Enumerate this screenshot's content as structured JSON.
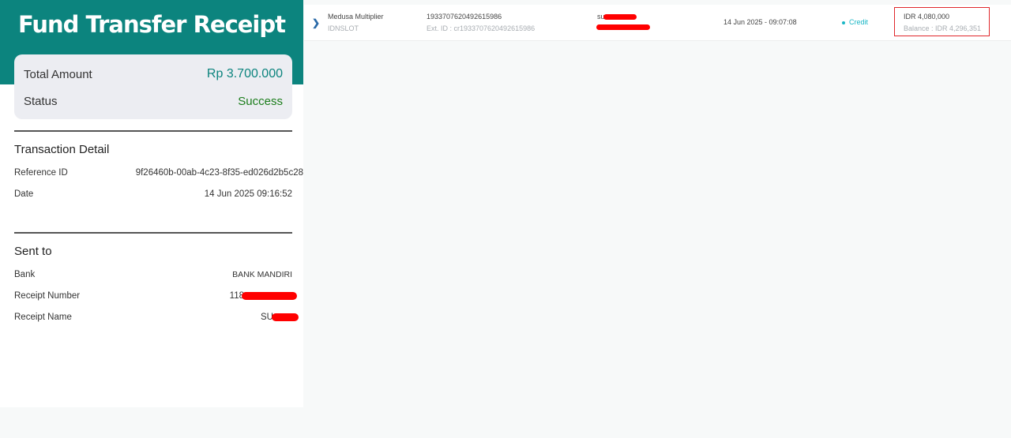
{
  "receipt": {
    "title": "Fund Transfer Receipt",
    "total_amount_label": "Total Amount",
    "total_amount_value": "Rp 3.700.000",
    "status_label": "Status",
    "status_value": "Success",
    "transaction_detail_heading": "Transaction Detail",
    "reference_id_label": "Reference ID",
    "reference_id_value": "9f26460b-00ab-4c23-8f35-ed026d2b5c28",
    "date_label": "Date",
    "date_value": "14 Jun 2025 09:16:52",
    "sent_to_heading": "Sent to",
    "bank_label": "Bank",
    "bank_value": "BANK MANDIRI",
    "receipt_number_label": "Receipt Number",
    "receipt_number_visible": "118",
    "receipt_name_label": "Receipt Name",
    "receipt_name_visible": "SU"
  },
  "transaction_row": {
    "expand_icon": "chevron-right-icon",
    "game_name": "Medusa Multiplier",
    "provider": "IDNSLOT",
    "transaction_id": "193370762049261598​6",
    "external_id": "Ext. ID : cr1933707620492615986",
    "user_visible": "su",
    "datetime": "14 Jun 2025 - 09:07:08",
    "type": "Credit",
    "amount": "IDR 4,080,000",
    "balance": "Balance : IDR 4,296,351",
    "colors": {
      "accent": "#0c847e",
      "credit": "#19b6c5",
      "highlight": "#e0282c",
      "redaction": "#ff0000"
    }
  }
}
